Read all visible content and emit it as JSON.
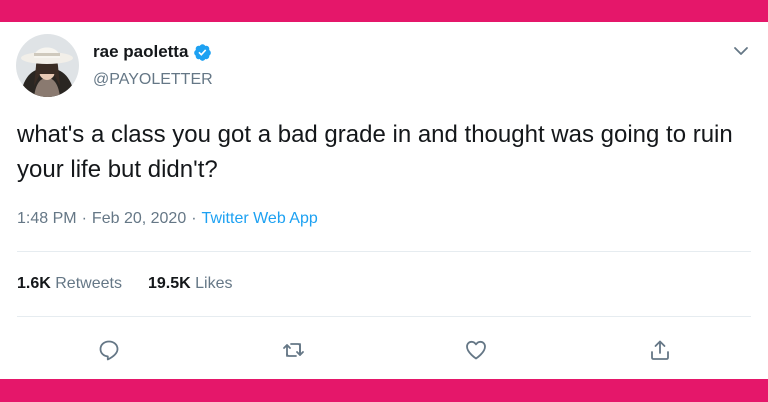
{
  "tweet": {
    "author_name": "rae paoletta",
    "author_handle": "@PAYOLETTER",
    "text": "what's a class you got a bad grade in and thought was going to ruin your life but didn't?",
    "time": "1:48 PM",
    "date": "Feb 20, 2020",
    "source": "Twitter Web App",
    "separator": "·",
    "retweets_count": "1.6K",
    "retweets_label": "Retweets",
    "likes_count": "19.5K",
    "likes_label": "Likes"
  },
  "icons": {
    "verified": "verified-badge-icon",
    "menu": "chevron-down-icon",
    "reply": "reply-icon",
    "retweet": "retweet-icon",
    "like": "heart-icon",
    "share": "share-icon"
  },
  "colors": {
    "background_border": "#e5176a",
    "card": "#ffffff",
    "accent_blue": "#1da1f2",
    "text_primary": "#14171a",
    "text_secondary": "#657786"
  }
}
